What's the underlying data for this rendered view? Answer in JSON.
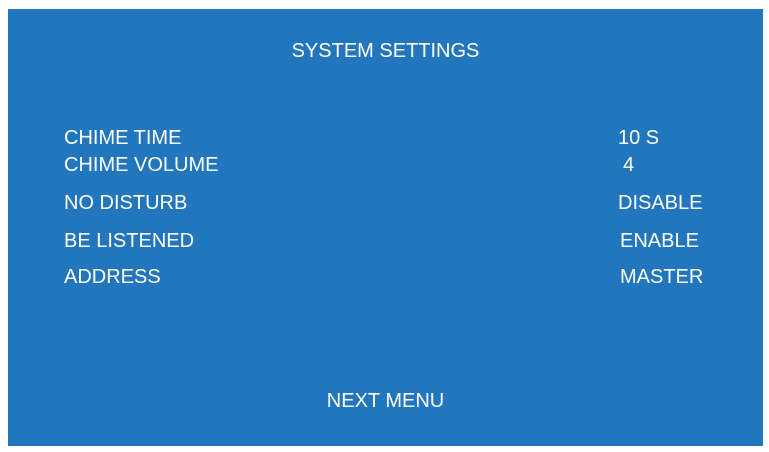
{
  "screen": {
    "background_color": "#2176bd",
    "text_color": "#ffffff"
  },
  "title": "SYSTEM SETTINGS",
  "settings": [
    {
      "label": "CHIME TIME",
      "value": "10 S"
    },
    {
      "label": "CHIME VOLUME",
      "value": "4"
    },
    {
      "label": "NO DISTURB",
      "value": "DISABLE"
    },
    {
      "label": "BE LISTENED",
      "value": "ENABLE"
    },
    {
      "label": "ADDRESS",
      "value": "MASTER"
    }
  ],
  "next_menu_label": "NEXT MENU"
}
